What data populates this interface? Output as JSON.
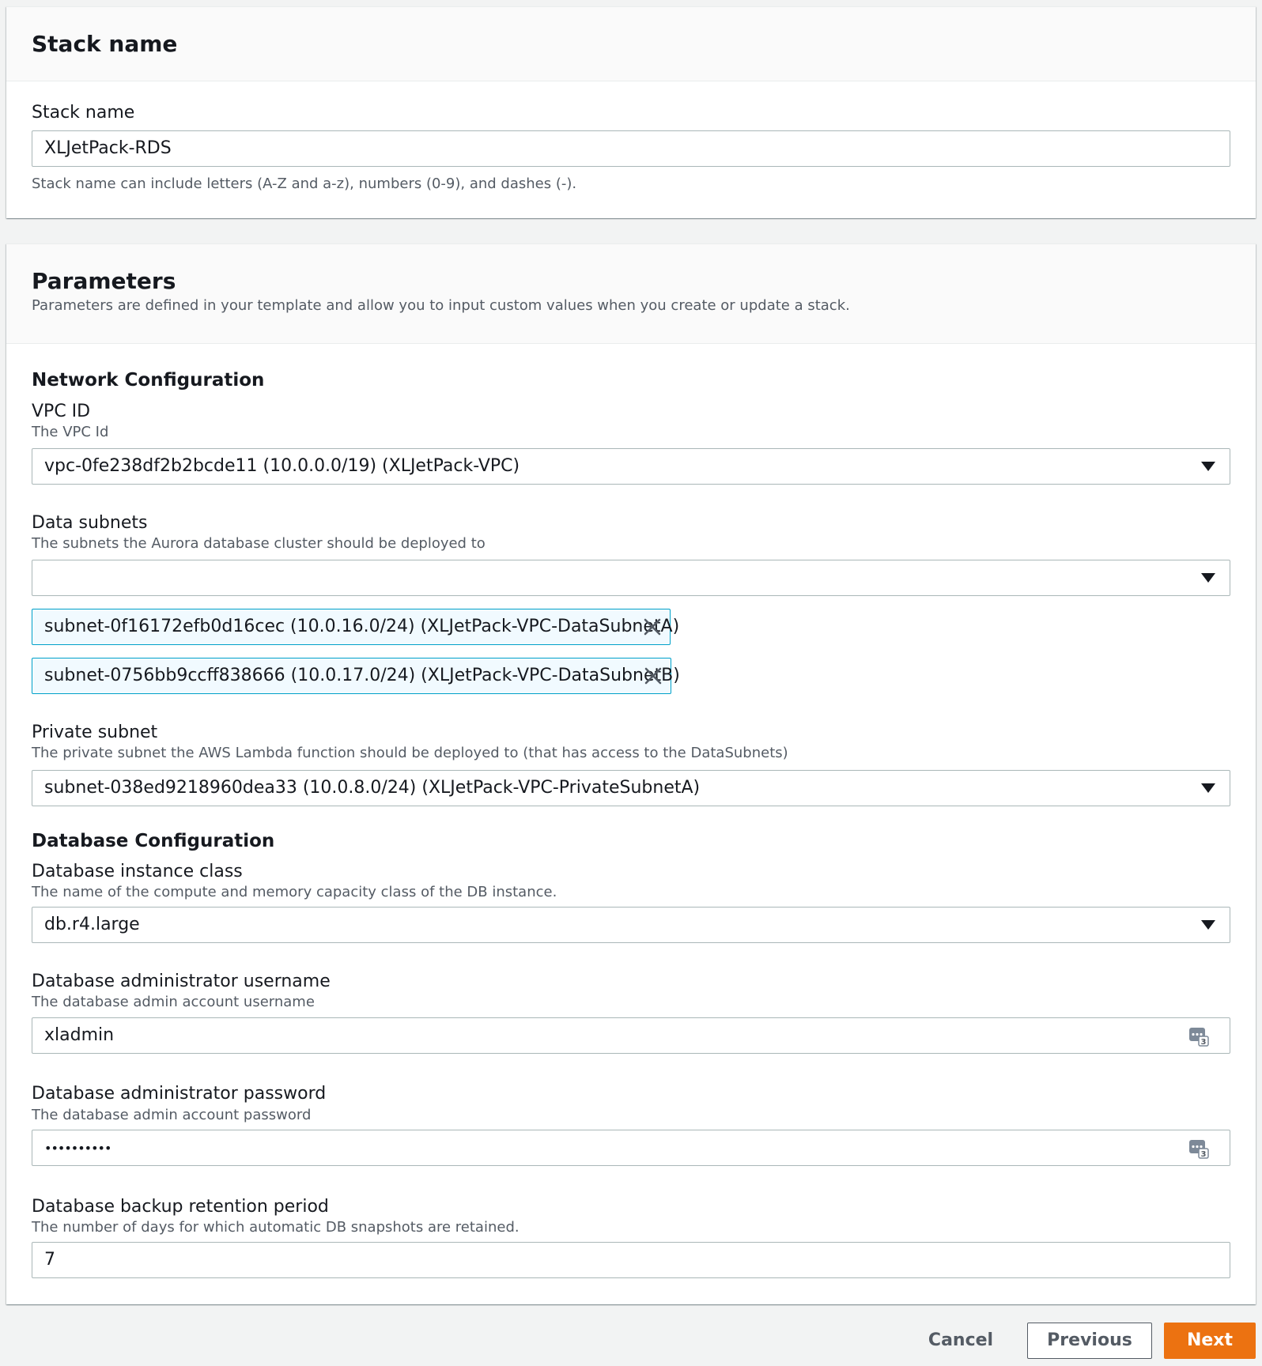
{
  "stack_panel": {
    "title": "Stack name",
    "field_label": "Stack name",
    "field_value": "XLJetPack-RDS",
    "hint": "Stack name can include letters (A-Z and a-z), numbers (0-9), and dashes (-)."
  },
  "parameters_panel": {
    "title": "Parameters",
    "description": "Parameters are defined in your template and allow you to input custom values when you create or update a stack.",
    "network_section": "Network Configuration",
    "vpc": {
      "label": "VPC ID",
      "description": "The VPC Id",
      "value": "vpc-0fe238df2b2bcde11 (10.0.0.0/19) (XLJetPack-VPC)"
    },
    "data_subnets": {
      "label": "Data subnets",
      "description": "The subnets the Aurora database cluster should be deployed to",
      "value": "",
      "tokens": [
        "subnet-0f16172efb0d16cec (10.0.16.0/24) (XLJetPack-VPC-DataSubnetA)",
        "subnet-0756bb9ccff838666 (10.0.17.0/24) (XLJetPack-VPC-DataSubnetB)"
      ]
    },
    "private_subnet": {
      "label": "Private subnet",
      "description": "The private subnet the AWS Lambda function should be deployed to (that has access to the DataSubnets)",
      "value": "subnet-038ed9218960dea33 (10.0.8.0/24) (XLJetPack-VPC-PrivateSubnetA)"
    },
    "database_section": "Database Configuration",
    "instance_class": {
      "label": "Database instance class",
      "description": "The name of the compute and memory capacity class of the DB instance.",
      "value": "db.r4.large"
    },
    "admin_username": {
      "label": "Database administrator username",
      "description": "The database admin account username",
      "value": "xladmin"
    },
    "admin_password": {
      "label": "Database administrator password",
      "description": "The database admin account password",
      "value": "••••••••••"
    },
    "backup_retention": {
      "label": "Database backup retention period",
      "description": "The number of days for which automatic DB snapshots are retained.",
      "value": "7"
    }
  },
  "footer": {
    "cancel_label": "Cancel",
    "previous_label": "Previous",
    "next_label": "Next"
  },
  "colors": {
    "primary": "#ec7211",
    "token_border": "#00a1c9",
    "token_bg": "#f1faff"
  },
  "icons": {
    "dropdown": "caret-down-icon",
    "remove_token": "close-icon",
    "password_manager": "password-manager-icon"
  }
}
